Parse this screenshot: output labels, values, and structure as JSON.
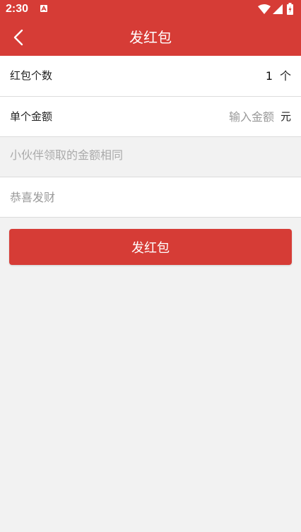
{
  "status_bar": {
    "time": "2:30",
    "icons": [
      "notification-a-icon",
      "wifi-icon",
      "signal-icon",
      "battery-icon"
    ]
  },
  "toolbar": {
    "title": "发红包",
    "back_icon": "chevron-left-icon"
  },
  "form": {
    "count": {
      "label": "红包个数",
      "value": "1",
      "unit": "个"
    },
    "amount": {
      "label": "单个金额",
      "placeholder": "输入金额",
      "unit": "元"
    },
    "hint": "小伙伴领取的金额相同",
    "greeting": {
      "placeholder": "恭喜发财"
    }
  },
  "submit_label": "发红包",
  "colors": {
    "brand_red": "#d63c36",
    "background": "#f2f2f2",
    "row_background": "#ffffff",
    "placeholder_gray": "#999999"
  }
}
